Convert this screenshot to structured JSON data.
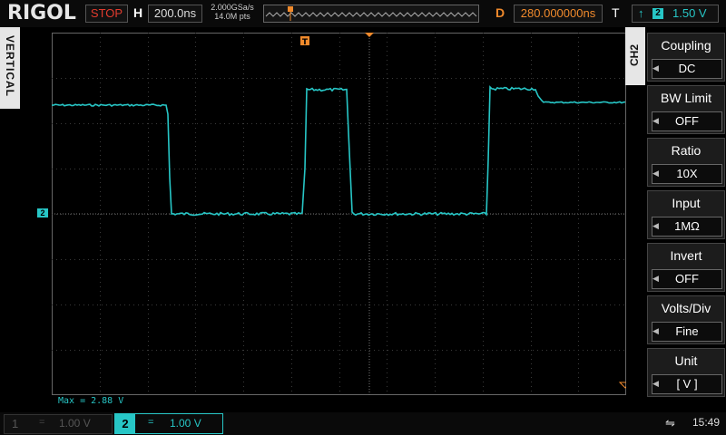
{
  "top": {
    "brand": "RIGOL",
    "run_state": "STOP",
    "h_label": "H",
    "timebase": "200.0ns",
    "sample_rate": "2.000GSa/s",
    "mem_depth": "14.0M pts",
    "d_label": "D",
    "delay": "280.000000ns",
    "t_label": "T",
    "trigger_source": "2",
    "trigger_level": "1.50 V"
  },
  "left_tab": {
    "label": "VERTICAL"
  },
  "channel_marker": "2",
  "measurement": "Max = 2.88 V",
  "menu": {
    "tab": "CH2",
    "items": [
      {
        "title": "Coupling",
        "value": "DC"
      },
      {
        "title": "BW Limit",
        "value": "OFF"
      },
      {
        "title": "Ratio",
        "value": "10X"
      },
      {
        "title": "Input",
        "value": "1MΩ"
      },
      {
        "title": "Invert",
        "value": "OFF"
      },
      {
        "title": "Volts/Div",
        "value": "Fine"
      },
      {
        "title": "Unit",
        "value": "[  V  ]"
      }
    ]
  },
  "bottom": {
    "ch1": {
      "num": "1",
      "coupling": "=",
      "scale": "1.00 V"
    },
    "ch2": {
      "num": "2",
      "coupling": "=",
      "scale": "1.00 V"
    },
    "time": "15:49"
  },
  "colors": {
    "ch2": "#27c6c6",
    "trigger": "#f08a2c",
    "stop": "#e23b2e"
  },
  "icons": [
    "trigger-marker-icon",
    "rising-edge-icon",
    "usb-icon",
    "arrow-left-icon"
  ]
}
